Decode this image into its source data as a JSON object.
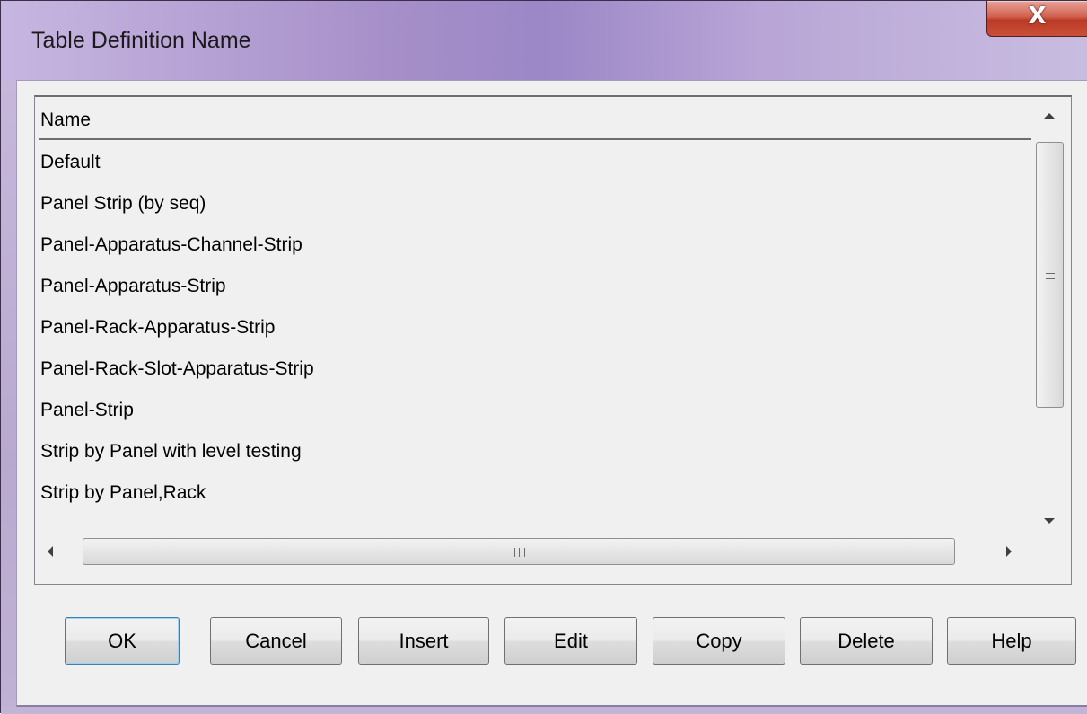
{
  "window": {
    "title": "Table Definition Name",
    "close_glyph": "X",
    "close_icon": "close-icon"
  },
  "list": {
    "column_header": "Name",
    "items": [
      "Default",
      "Panel Strip (by seq)",
      "Panel-Apparatus-Channel-Strip",
      "Panel-Apparatus-Strip",
      "Panel-Rack-Apparatus-Strip",
      "Panel-Rack-Slot-Apparatus-Strip",
      "Panel-Strip",
      "Strip by Panel with level testing",
      "Strip by Panel,Rack"
    ]
  },
  "buttons": {
    "ok": "OK",
    "cancel": "Cancel",
    "insert": "Insert",
    "edit": "Edit",
    "copy": "Copy",
    "delete": "Delete",
    "help": "Help"
  },
  "colors": {
    "title_bar": "#a790c9",
    "close_button": "#c9503a",
    "dialog_background": "#f0f0f0",
    "default_button_border": "#3c7fb1"
  }
}
